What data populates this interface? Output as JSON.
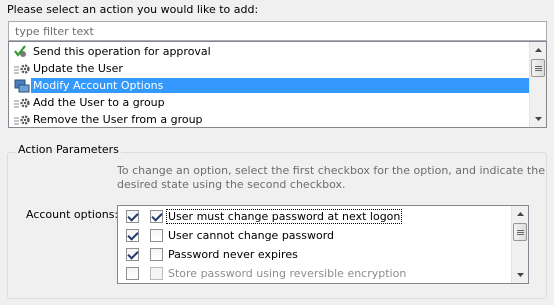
{
  "prompt": "Please select an action you would like to add:",
  "filter": {
    "placeholder": "type filter text",
    "value": ""
  },
  "actions": [
    {
      "label": "Send this operation for approval",
      "icon": "approval-check-icon",
      "selected": false
    },
    {
      "label": "Update the User",
      "icon": "gear-icon",
      "selected": false
    },
    {
      "label": "Modify Account Options",
      "icon": "user-options-icon",
      "selected": true
    },
    {
      "label": "Add the User to a group",
      "icon": "gear-icon",
      "selected": false
    },
    {
      "label": "Remove the User from a group",
      "icon": "gear-icon",
      "selected": false
    }
  ],
  "action_parameters": {
    "title": "Action Parameters",
    "instructions": "To change an option, select the first checkbox for the option, and indicate the desired state using the second checkbox.",
    "account_options_label": "Account options:",
    "options": [
      {
        "label": "User must change password at next logon",
        "enabled": true,
        "value": true,
        "disabled": false
      },
      {
        "label": "User cannot change password",
        "enabled": true,
        "value": false,
        "disabled": false
      },
      {
        "label": "Password never expires",
        "enabled": true,
        "value": false,
        "disabled": false
      },
      {
        "label": "Store password using reversible encryption",
        "enabled": false,
        "value": false,
        "disabled": true
      }
    ]
  },
  "colors": {
    "selection": "#3399ff",
    "group_border": "#d5dfe5",
    "hint_text": "#6d6d6d"
  }
}
